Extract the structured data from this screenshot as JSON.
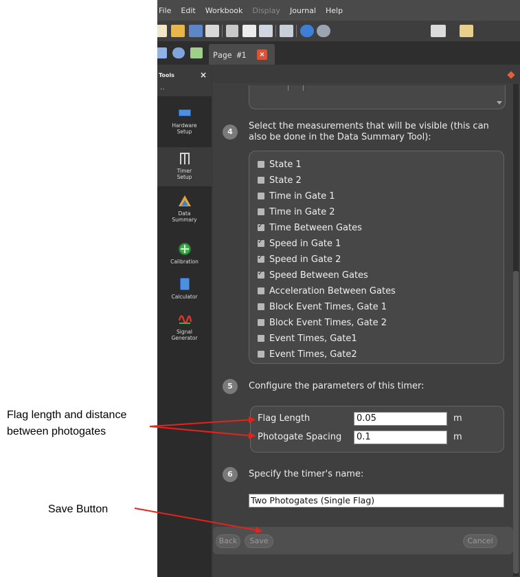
{
  "menu": {
    "file": "File",
    "edit": "Edit",
    "workbook": "Workbook",
    "display": "Display",
    "journal": "Journal",
    "help": "Help"
  },
  "tab": {
    "label": "Page #1"
  },
  "tools": {
    "title": "Tools",
    "close": "×",
    "dots": "‥",
    "items": [
      {
        "label": "Hardware\nSetup",
        "icon": "hardware-setup-icon"
      },
      {
        "label": "Timer\nSetup",
        "icon": "timer-setup-icon"
      },
      {
        "label": "Data\nSummary",
        "icon": "data-summary-icon"
      },
      {
        "label": "Calibration",
        "icon": "calibration-icon"
      },
      {
        "label": "Calculator",
        "icon": "calculator-icon"
      },
      {
        "label": "Signal\nGenerator",
        "icon": "signal-generator-icon"
      }
    ]
  },
  "step4": {
    "number": "4",
    "text": "Select the measurements that will be visible (this can also be done in the Data Summary Tool):"
  },
  "measurements": [
    {
      "label": "State 1",
      "checked": false
    },
    {
      "label": "State 2",
      "checked": false
    },
    {
      "label": "Time in Gate 1",
      "checked": false
    },
    {
      "label": "Time in Gate 2",
      "checked": false
    },
    {
      "label": "Time Between Gates",
      "checked": true
    },
    {
      "label": "Speed in Gate 1",
      "checked": true
    },
    {
      "label": "Speed in Gate 2",
      "checked": true
    },
    {
      "label": "Speed Between Gates",
      "checked": true
    },
    {
      "label": "Acceleration Between Gates",
      "checked": false
    },
    {
      "label": "Block Event Times, Gate 1",
      "checked": false
    },
    {
      "label": "Block Event Times, Gate 2",
      "checked": false
    },
    {
      "label": "Event Times, Gate1",
      "checked": false
    },
    {
      "label": "Event Times, Gate2",
      "checked": false
    }
  ],
  "step5": {
    "number": "5",
    "text": "Configure the parameters of this timer:"
  },
  "params": {
    "flag_length": {
      "label": "Flag Length",
      "value": "0.05",
      "unit": "m"
    },
    "photogate_spacing": {
      "label": "Photogate Spacing",
      "value": "0.1",
      "unit": "m"
    }
  },
  "step6": {
    "number": "6",
    "text": "Specify the timer's name:",
    "value": "Two Photogates (Single Flag)"
  },
  "buttons": {
    "back": "Back",
    "save": "Save",
    "cancel": "Cancel"
  },
  "annotations": {
    "flag_line1": "Flag length and distance",
    "flag_line2": "between photogates",
    "save": "Save Button",
    "arrow_color": "#e8221b"
  }
}
